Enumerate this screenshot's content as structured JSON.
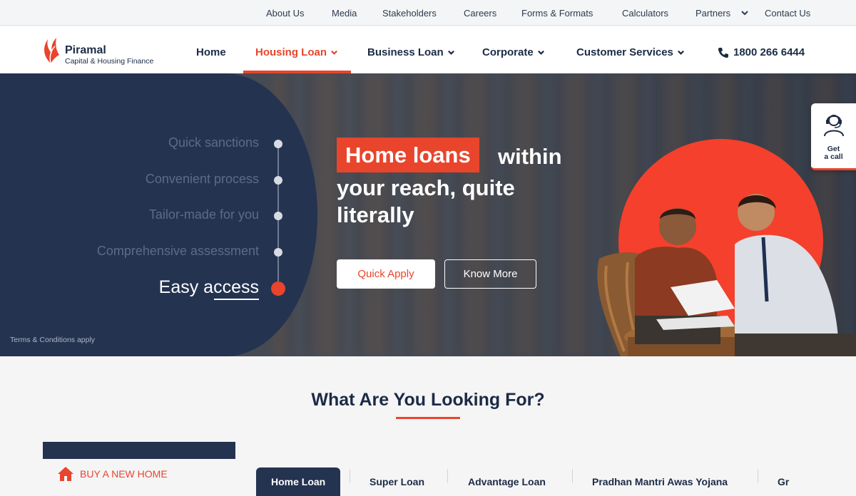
{
  "topbar": {
    "links": [
      "About Us",
      "Media",
      "Stakeholders",
      "Careers",
      "Forms & Formats",
      "Calculators",
      "Partners",
      "Contact Us"
    ]
  },
  "brand": {
    "name": "Piramal",
    "tagline": "Capital & Housing Finance"
  },
  "nav": {
    "items": [
      "Home",
      "Housing Loan",
      "Business Loan",
      "Corporate",
      "Customer Services"
    ],
    "active": "Housing Loan",
    "phone": "1800 266 6444"
  },
  "hero": {
    "steps": [
      "Quick sanctions",
      "Convenient process",
      "Tailor-made for you",
      "Comprehensive assessment",
      "Easy access"
    ],
    "active_step": "Easy access",
    "terms": "Terms & Conditions apply",
    "headline_highlight": "Home loans",
    "headline_word": "within",
    "headline_line2": "your reach, quite",
    "headline_line3": "literally",
    "primary_cta": "Quick Apply",
    "secondary_cta": "Know More"
  },
  "get_call": {
    "line1": "Get",
    "line2": "a call"
  },
  "looking_for": {
    "title": "What Are You Looking For?",
    "buy_label": "BUY A NEW HOME",
    "tabs": [
      "Home Loan",
      "Super Loan",
      "Advantage Loan",
      "Pradhan Mantri Awas Yojana",
      "Gr"
    ]
  },
  "colors": {
    "accent": "#e8452c",
    "navy": "#243350",
    "text": "#1c2b45"
  },
  "icons": [
    "chevron-down-icon",
    "phone-icon",
    "customer-support-icon",
    "home-icon",
    "piramal-logo-mark"
  ]
}
